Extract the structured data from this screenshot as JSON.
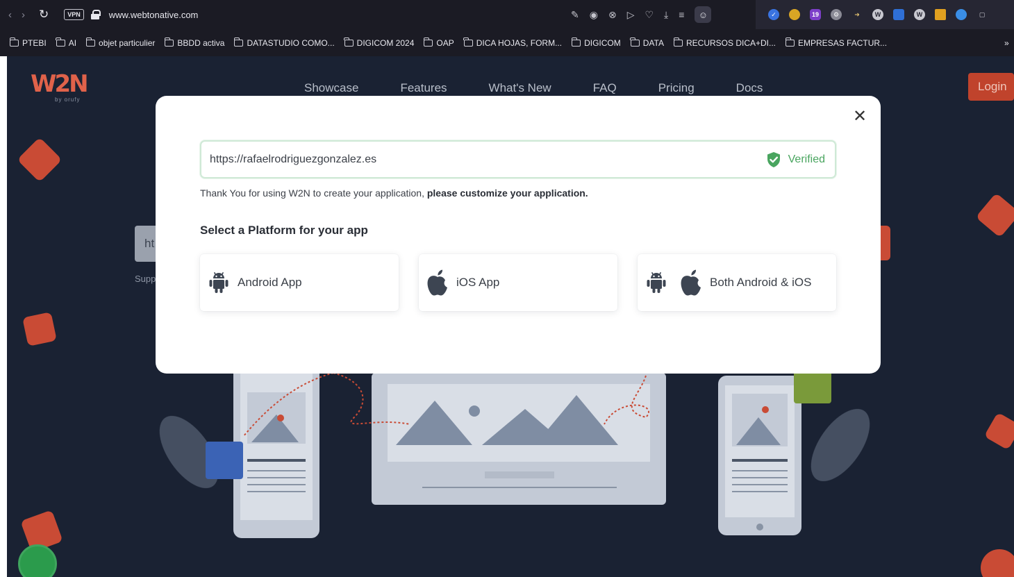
{
  "browser": {
    "vpn_label": "VPN",
    "url": "www.webtonative.com",
    "ext_badge": "19",
    "bookmarks": [
      "PTEBI",
      "AI",
      "objet particulier",
      "BBDD activa",
      "DATASTUDIO COMO...",
      "DIGICOM 2024",
      "OAP",
      "DICA HOJAS, FORM...",
      "DIGICOM",
      "DATA",
      "RECURSOS DICA+DI...",
      "EMPRESAS FACTUR..."
    ]
  },
  "site": {
    "logo": "W2N",
    "logo_sub": "by orufy",
    "nav": [
      "Showcase",
      "Features",
      "What's New",
      "FAQ",
      "Pricing",
      "Docs"
    ],
    "login_label": "Login",
    "bg_input_text": "ht",
    "bg_support_text": "Supp"
  },
  "modal": {
    "url_value": "https://rafaelrodriguezgonzalez.es",
    "verified_label": "Verified",
    "thanks_text": "Thank You for using W2N to create your application, ",
    "thanks_bold": "please customize your application.",
    "platform_title": "Select a Platform for your app",
    "options": [
      {
        "label": "Android App",
        "icons": [
          "android-icon"
        ]
      },
      {
        "label": "iOS App",
        "icons": [
          "apple-icon"
        ]
      },
      {
        "label": "Both Android & iOS",
        "icons": [
          "android-icon",
          "apple-icon"
        ]
      }
    ]
  },
  "colors": {
    "page_bg": "#1a2233",
    "accent": "#c94b35",
    "verified_green": "#49a55f",
    "icon_dark": "#3d4552"
  }
}
